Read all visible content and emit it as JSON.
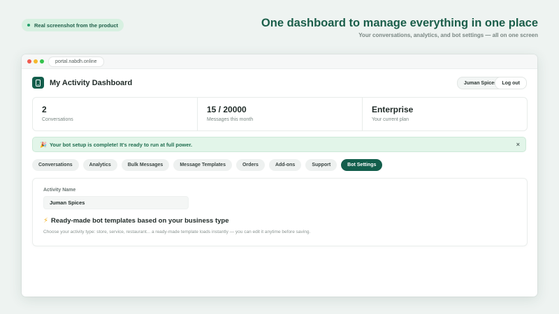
{
  "hero": {
    "badge": "Real screenshot from the product",
    "title": "One dashboard to manage everything in one place",
    "subtitle": "Your conversations, analytics, and bot settings — all on one screen"
  },
  "browser": {
    "url": "portal.nabdh.online"
  },
  "header": {
    "title": "My Activity Dashboard",
    "user_button": "Juman Spices",
    "logout_button": "Log out"
  },
  "stats": [
    {
      "value": "2",
      "label": "Conversations"
    },
    {
      "value": "15 / 20000",
      "label": "Messages this month"
    },
    {
      "value": "Enterprise",
      "label": "Your current plan"
    }
  ],
  "banner": {
    "emoji": "🎉",
    "text": "Your bot setup is complete! It's ready to run at full power.",
    "close": "×"
  },
  "tabs": [
    {
      "label": "Conversations"
    },
    {
      "label": "Analytics"
    },
    {
      "label": "Bulk Messages"
    },
    {
      "label": "Message Templates"
    },
    {
      "label": "Orders"
    },
    {
      "label": "Add-ons"
    },
    {
      "label": "Support"
    },
    {
      "label": "Bot Settings"
    }
  ],
  "settings": {
    "activity_name_label": "Activity Name",
    "activity_name_value": "Juman Spices",
    "templates_icon": "⚡",
    "templates_title": "Ready-made bot templates based on your business type",
    "templates_desc": "Choose your activity type: store, service, restaurant... a ready-made template loads instantly — you can edit it anytime before saving."
  },
  "colors": {
    "brand": "#135e4c",
    "accent_green": "#22a06b",
    "banner_bg": "#e2f5e9",
    "page_bg": "#eef3f1"
  },
  "icons": {
    "logo": "app-logo-icon",
    "bolt": "lightning-icon",
    "close": "close-icon"
  }
}
